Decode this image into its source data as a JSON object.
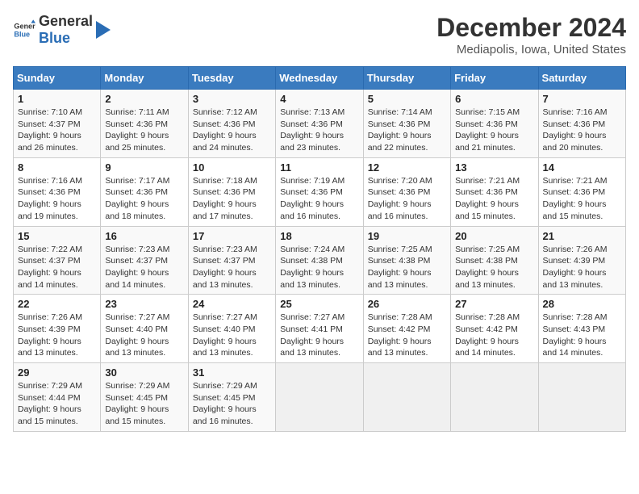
{
  "header": {
    "logo_general": "General",
    "logo_blue": "Blue",
    "title": "December 2024",
    "subtitle": "Mediapolis, Iowa, United States"
  },
  "calendar": {
    "days_of_week": [
      "Sunday",
      "Monday",
      "Tuesday",
      "Wednesday",
      "Thursday",
      "Friday",
      "Saturday"
    ],
    "weeks": [
      [
        {
          "day": "1",
          "sunrise": "7:10 AM",
          "sunset": "4:37 PM",
          "daylight": "9 hours and 26 minutes."
        },
        {
          "day": "2",
          "sunrise": "7:11 AM",
          "sunset": "4:36 PM",
          "daylight": "9 hours and 25 minutes."
        },
        {
          "day": "3",
          "sunrise": "7:12 AM",
          "sunset": "4:36 PM",
          "daylight": "9 hours and 24 minutes."
        },
        {
          "day": "4",
          "sunrise": "7:13 AM",
          "sunset": "4:36 PM",
          "daylight": "9 hours and 23 minutes."
        },
        {
          "day": "5",
          "sunrise": "7:14 AM",
          "sunset": "4:36 PM",
          "daylight": "9 hours and 22 minutes."
        },
        {
          "day": "6",
          "sunrise": "7:15 AM",
          "sunset": "4:36 PM",
          "daylight": "9 hours and 21 minutes."
        },
        {
          "day": "7",
          "sunrise": "7:16 AM",
          "sunset": "4:36 PM",
          "daylight": "9 hours and 20 minutes."
        }
      ],
      [
        {
          "day": "8",
          "sunrise": "7:16 AM",
          "sunset": "4:36 PM",
          "daylight": "9 hours and 19 minutes."
        },
        {
          "day": "9",
          "sunrise": "7:17 AM",
          "sunset": "4:36 PM",
          "daylight": "9 hours and 18 minutes."
        },
        {
          "day": "10",
          "sunrise": "7:18 AM",
          "sunset": "4:36 PM",
          "daylight": "9 hours and 17 minutes."
        },
        {
          "day": "11",
          "sunrise": "7:19 AM",
          "sunset": "4:36 PM",
          "daylight": "9 hours and 16 minutes."
        },
        {
          "day": "12",
          "sunrise": "7:20 AM",
          "sunset": "4:36 PM",
          "daylight": "9 hours and 16 minutes."
        },
        {
          "day": "13",
          "sunrise": "7:21 AM",
          "sunset": "4:36 PM",
          "daylight": "9 hours and 15 minutes."
        },
        {
          "day": "14",
          "sunrise": "7:21 AM",
          "sunset": "4:36 PM",
          "daylight": "9 hours and 15 minutes."
        }
      ],
      [
        {
          "day": "15",
          "sunrise": "7:22 AM",
          "sunset": "4:37 PM",
          "daylight": "9 hours and 14 minutes."
        },
        {
          "day": "16",
          "sunrise": "7:23 AM",
          "sunset": "4:37 PM",
          "daylight": "9 hours and 14 minutes."
        },
        {
          "day": "17",
          "sunrise": "7:23 AM",
          "sunset": "4:37 PM",
          "daylight": "9 hours and 13 minutes."
        },
        {
          "day": "18",
          "sunrise": "7:24 AM",
          "sunset": "4:38 PM",
          "daylight": "9 hours and 13 minutes."
        },
        {
          "day": "19",
          "sunrise": "7:25 AM",
          "sunset": "4:38 PM",
          "daylight": "9 hours and 13 minutes."
        },
        {
          "day": "20",
          "sunrise": "7:25 AM",
          "sunset": "4:38 PM",
          "daylight": "9 hours and 13 minutes."
        },
        {
          "day": "21",
          "sunrise": "7:26 AM",
          "sunset": "4:39 PM",
          "daylight": "9 hours and 13 minutes."
        }
      ],
      [
        {
          "day": "22",
          "sunrise": "7:26 AM",
          "sunset": "4:39 PM",
          "daylight": "9 hours and 13 minutes."
        },
        {
          "day": "23",
          "sunrise": "7:27 AM",
          "sunset": "4:40 PM",
          "daylight": "9 hours and 13 minutes."
        },
        {
          "day": "24",
          "sunrise": "7:27 AM",
          "sunset": "4:40 PM",
          "daylight": "9 hours and 13 minutes."
        },
        {
          "day": "25",
          "sunrise": "7:27 AM",
          "sunset": "4:41 PM",
          "daylight": "9 hours and 13 minutes."
        },
        {
          "day": "26",
          "sunrise": "7:28 AM",
          "sunset": "4:42 PM",
          "daylight": "9 hours and 13 minutes."
        },
        {
          "day": "27",
          "sunrise": "7:28 AM",
          "sunset": "4:42 PM",
          "daylight": "9 hours and 14 minutes."
        },
        {
          "day": "28",
          "sunrise": "7:28 AM",
          "sunset": "4:43 PM",
          "daylight": "9 hours and 14 minutes."
        }
      ],
      [
        {
          "day": "29",
          "sunrise": "7:29 AM",
          "sunset": "4:44 PM",
          "daylight": "9 hours and 15 minutes."
        },
        {
          "day": "30",
          "sunrise": "7:29 AM",
          "sunset": "4:45 PM",
          "daylight": "9 hours and 15 minutes."
        },
        {
          "day": "31",
          "sunrise": "7:29 AM",
          "sunset": "4:45 PM",
          "daylight": "9 hours and 16 minutes."
        },
        null,
        null,
        null,
        null
      ]
    ]
  }
}
